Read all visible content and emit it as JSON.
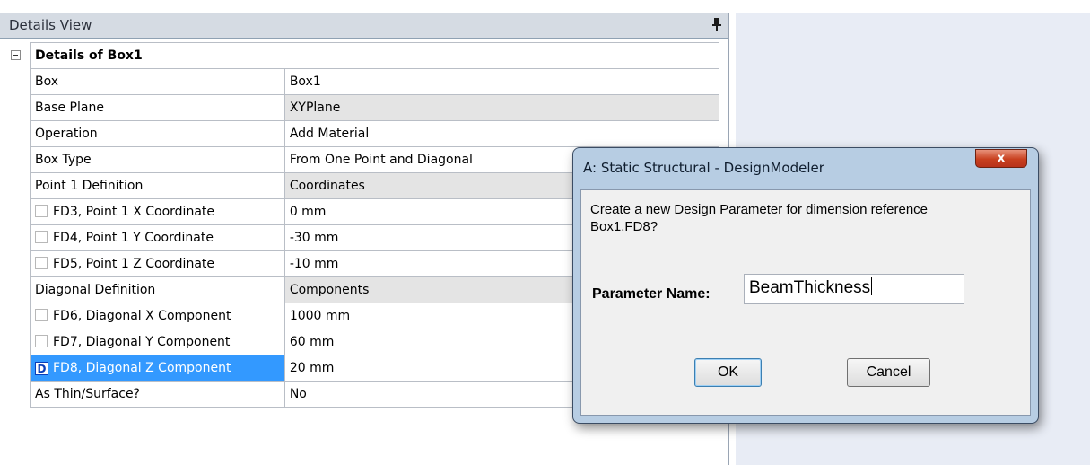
{
  "panel": {
    "title": "Details View",
    "pin_icon": "pin-icon"
  },
  "tree": {
    "header": "Details of Box1",
    "rows": [
      {
        "label": "Box",
        "value": "Box1"
      },
      {
        "label": "Base Plane",
        "value": "XYPlane"
      },
      {
        "label": "Operation",
        "value": "Add Material"
      },
      {
        "label": "Box Type",
        "value": "From One Point and Diagonal"
      },
      {
        "label": "Point 1 Definition",
        "value": "Coordinates"
      },
      {
        "label": "FD3, Point 1 X Coordinate",
        "value": "0 mm"
      },
      {
        "label": "FD4, Point 1 Y Coordinate",
        "value": "-30 mm"
      },
      {
        "label": "FD5, Point 1 Z Coordinate",
        "value": "-10 mm"
      },
      {
        "label": "Diagonal Definition",
        "value": "Components"
      },
      {
        "label": "FD6, Diagonal X Component",
        "value": "1000 mm"
      },
      {
        "label": "FD7, Diagonal Y Component",
        "value": "60 mm"
      },
      {
        "label": "FD8, Diagonal Z Component",
        "value": "20 mm",
        "checkbox_mark": "D"
      },
      {
        "label": "As Thin/Surface?",
        "value": "No"
      }
    ]
  },
  "dialog": {
    "title": "A: Static Structural - DesignModeler",
    "close_label": "x",
    "message_line1": "Create a new Design Parameter for dimension reference",
    "message_line2": "Box1.FD8?",
    "field_label": "Parameter Name:",
    "field_value": "BeamThickness",
    "ok_label": "OK",
    "cancel_label": "Cancel"
  },
  "colors": {
    "selection": "#3399ff",
    "header_bg": "#d5dbe3",
    "dialog_frame": "#b7cde3"
  }
}
